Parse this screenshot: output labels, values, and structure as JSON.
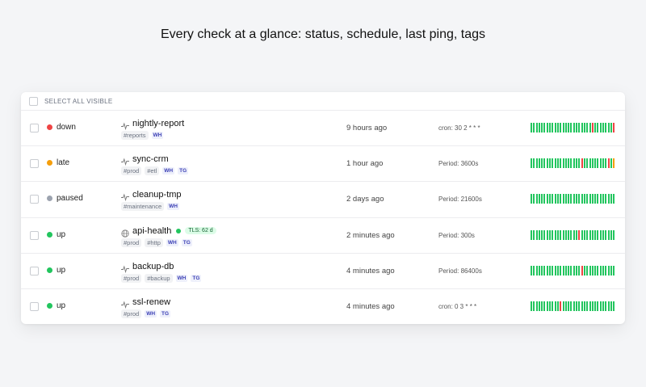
{
  "heading": "Every check at a glance: status, schedule, last ping, tags",
  "select_all_label": "SELECT ALL VISIBLE",
  "colors": {
    "down": "#ef4444",
    "late": "#f59e0b",
    "paused": "#9ca3af",
    "up": "#22c55e",
    "bar_ok": "#22c55e",
    "bar_fail": "#ef4444",
    "bar_late": "#f59e0b"
  },
  "checks": [
    {
      "status": "down",
      "status_color": "#ef4444",
      "kind_icon": "heartbeat-icon",
      "name": "nightly-report",
      "tags": [
        "#reports"
      ],
      "channels": [
        "WH"
      ],
      "last_ping": "9 hours ago",
      "schedule": "cron: 30 2 * * *",
      "history": "GGGGGGGGGGGGGGGGGGGGGGGRGGGGGGGR"
    },
    {
      "status": "late",
      "status_color": "#f59e0b",
      "kind_icon": "heartbeat-icon",
      "name": "sync-crm",
      "tags": [
        "#prod",
        "#etl"
      ],
      "channels": [
        "WH",
        "TG"
      ],
      "last_ping": "1 hour ago",
      "schedule": "Period: 3600s",
      "history": "GGGGGGGGGGGGGGGGGGGRGGGGGGGGGRGY"
    },
    {
      "status": "paused",
      "status_color": "#9ca3af",
      "kind_icon": "heartbeat-icon",
      "name": "cleanup-tmp",
      "tags": [
        "#maintenance"
      ],
      "channels": [
        "WH"
      ],
      "last_ping": "2 days ago",
      "schedule": "Period: 21600s",
      "history": "GGGGGGGGGGGGGGGGGGGGGGGGGGGGGGGG"
    },
    {
      "status": "up",
      "status_color": "#22c55e",
      "kind_icon": "globe-icon",
      "name": "api-health",
      "tls_badge": "TLS: 62 d",
      "tags": [
        "#prod",
        "#http"
      ],
      "channels": [
        "WH",
        "TG"
      ],
      "last_ping": "2 minutes ago",
      "schedule": "Period: 300s",
      "history": "GGGGGGGGGGGGGGGGGGRGGGGGGGGGGGGG"
    },
    {
      "status": "up",
      "status_color": "#22c55e",
      "kind_icon": "heartbeat-icon",
      "name": "backup-db",
      "tags": [
        "#prod",
        "#backup"
      ],
      "channels": [
        "WH",
        "TG"
      ],
      "last_ping": "4 minutes ago",
      "schedule": "Period: 86400s",
      "history": "GGGGGGGGGGGGGGGGGGGRGGGGGGGGGGGG"
    },
    {
      "status": "up",
      "status_color": "#22c55e",
      "kind_icon": "heartbeat-icon",
      "name": "ssl-renew",
      "tags": [
        "#prod"
      ],
      "channels": [
        "WH",
        "TG"
      ],
      "last_ping": "4 minutes ago",
      "schedule": "cron: 0 3 * * *",
      "history": "GGGGGGGGGGGRGGGGGGGGGGGGGGGGGGGG"
    }
  ]
}
